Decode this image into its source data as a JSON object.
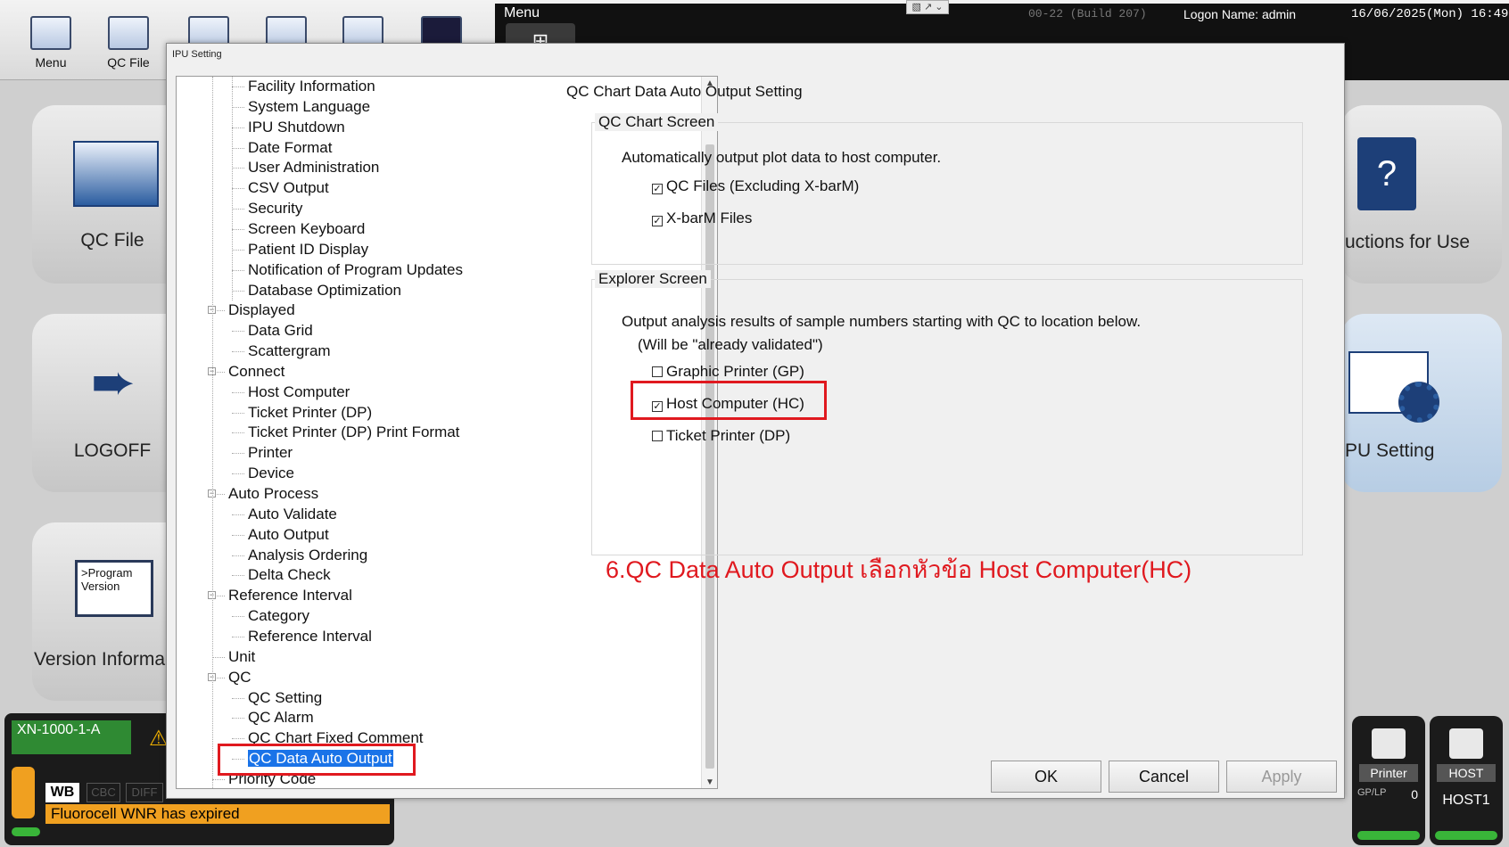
{
  "topbar": {
    "buttons": [
      {
        "label": "Menu",
        "icon": "grid-icon"
      },
      {
        "label": "QC File",
        "icon": "chart-icon"
      },
      {
        "label": "",
        "icon": "report-icon"
      },
      {
        "label": "",
        "icon": "list-icon"
      },
      {
        "label": "",
        "icon": "search-doc-icon"
      },
      {
        "label": "",
        "icon": "scattergram-icon"
      }
    ],
    "menu_title": "Menu",
    "build": "00-22 (Build 207)",
    "logon": "Logon Name: admin",
    "datetime": "16/06/2025(Mon) 16:49"
  },
  "background_cards": {
    "qc_file": "QC File",
    "logoff": "LOGOFF",
    "version": "Version Informa",
    "version_icon_text": ">Program Version",
    "instructions": "uctions for Use",
    "ipu_setting": "PU Setting"
  },
  "status_left": {
    "instrument": "XN-1000-1-A",
    "wb": "WB",
    "cbc": "CBC",
    "diff": "DIFF",
    "message": "Fluorocell WNR has expired"
  },
  "status_right": {
    "printer": {
      "label": "Printer",
      "sub": "GP/LP",
      "count": "0"
    },
    "host": {
      "label": "HOST",
      "name": "HOST1"
    }
  },
  "dialog": {
    "title": "IPU Setting",
    "tree": [
      {
        "label": "Facility Information",
        "level": 1
      },
      {
        "label": "System Language",
        "level": 1
      },
      {
        "label": "IPU Shutdown",
        "level": 1
      },
      {
        "label": "Date Format",
        "level": 1
      },
      {
        "label": "User Administration",
        "level": 1
      },
      {
        "label": "CSV Output",
        "level": 1
      },
      {
        "label": "Security",
        "level": 1
      },
      {
        "label": "Screen Keyboard",
        "level": 1
      },
      {
        "label": "Patient ID Display",
        "level": 1
      },
      {
        "label": "Notification of Program Updates",
        "level": 1
      },
      {
        "label": "Database Optimization",
        "level": 1
      },
      {
        "label": "Displayed",
        "level": 0,
        "expandable": true
      },
      {
        "label": "Data Grid",
        "level": 1
      },
      {
        "label": "Scattergram",
        "level": 1
      },
      {
        "label": "Connect",
        "level": 0,
        "expandable": true
      },
      {
        "label": "Host Computer",
        "level": 1
      },
      {
        "label": "Ticket Printer (DP)",
        "level": 1
      },
      {
        "label": "Ticket Printer (DP) Print Format",
        "level": 1
      },
      {
        "label": "Printer",
        "level": 1
      },
      {
        "label": "Device",
        "level": 1
      },
      {
        "label": "Auto Process",
        "level": 0,
        "expandable": true
      },
      {
        "label": "Auto Validate",
        "level": 1
      },
      {
        "label": "Auto Output",
        "level": 1
      },
      {
        "label": "Analysis Ordering",
        "level": 1
      },
      {
        "label": "Delta Check",
        "level": 1
      },
      {
        "label": "Reference Interval",
        "level": 0,
        "expandable": true
      },
      {
        "label": "Category",
        "level": 1
      },
      {
        "label": "Reference Interval",
        "level": 1
      },
      {
        "label": "Unit",
        "level": 0
      },
      {
        "label": "QC",
        "level": 0,
        "expandable": true
      },
      {
        "label": "QC Setting",
        "level": 1
      },
      {
        "label": "QC Alarm",
        "level": 1
      },
      {
        "label": "QC Chart Fixed Comment",
        "level": 1
      },
      {
        "label": "QC Data Auto Output",
        "level": 1,
        "selected": true
      },
      {
        "label": "Priority Code",
        "level": 0
      }
    ],
    "settings_title": "QC Chart Data Auto Output Setting",
    "qc_chart_screen": {
      "title": "QC Chart Screen",
      "description": "Automatically output plot data to host computer.",
      "options": [
        {
          "label": "QC Files (Excluding X-barM)",
          "checked": true
        },
        {
          "label": "X-barM Files",
          "checked": true
        }
      ]
    },
    "explorer_screen": {
      "title": "Explorer Screen",
      "description": "Output analysis results of sample numbers starting with QC to location below.",
      "note": "(Will be \"already validated\")",
      "options": [
        {
          "label": "Graphic Printer (GP)",
          "checked": false
        },
        {
          "label": "Host Computer (HC)",
          "checked": true
        },
        {
          "label": "Ticket Printer (DP)",
          "checked": false
        }
      ]
    },
    "annotation": "6.QC Data Auto Output เลือกหัวข้อ Host Computer(HC)",
    "buttons": {
      "ok": "OK",
      "cancel": "Cancel",
      "apply": "Apply"
    }
  },
  "colors": {
    "selection": "#1a73e8",
    "annotation_red": "#e0191f",
    "status_green": "#39b539",
    "warning_orange": "#f0a020"
  }
}
